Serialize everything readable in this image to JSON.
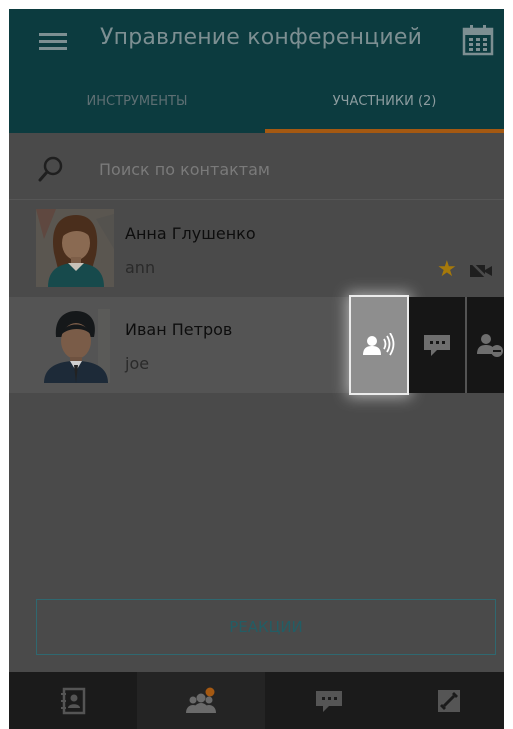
{
  "header": {
    "title": "Управление конференцией",
    "menu_icon": "hamburger-menu-icon",
    "calendar_icon": "calendar-icon"
  },
  "tabs": [
    {
      "label": "ИНСТРУМЕНТЫ",
      "active": false
    },
    {
      "label": "УЧАСТНИКИ (2)",
      "active": true
    }
  ],
  "search": {
    "placeholder": "Поиск по контактам",
    "value": "",
    "icon": "search-icon"
  },
  "contacts": [
    {
      "name": "Анна Глушенко",
      "login": "ann",
      "favorite": true,
      "video": "camera-off-icon"
    },
    {
      "name": "Иван Петров",
      "login": "joe"
    }
  ],
  "row_actions": {
    "audio": "speaking-user-icon",
    "chat": "chat-bubble-icon",
    "remove": "remove-user-icon"
  },
  "reactions_label": "РЕАКЦИИ",
  "bottom_nav": [
    {
      "icon": "address-book-icon"
    },
    {
      "icon": "participants-icon",
      "active": true
    },
    {
      "icon": "chat-icon"
    },
    {
      "icon": "call-icon"
    }
  ],
  "colors": {
    "header_bg": "#0c3b3f",
    "tab_indicator": "#a55912",
    "star": "#a6790a",
    "overlay": "#4a4a4a"
  }
}
